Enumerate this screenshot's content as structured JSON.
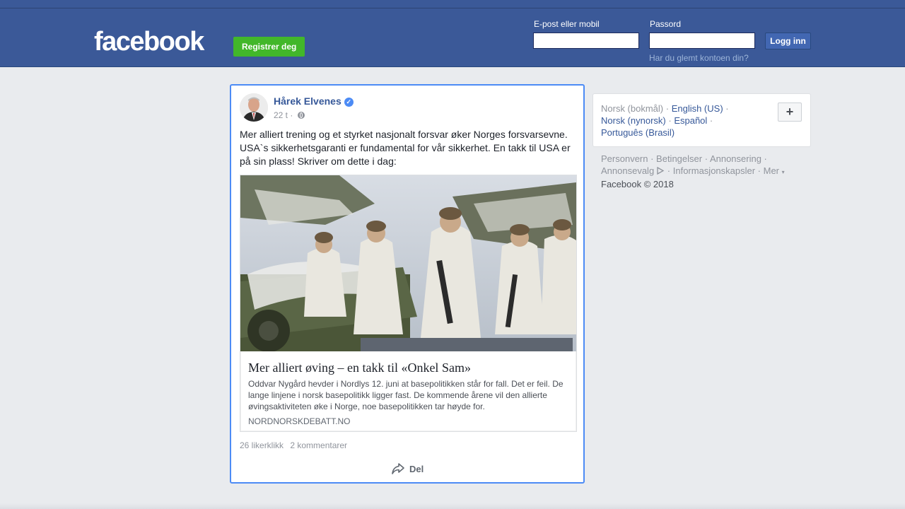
{
  "header": {
    "logo": "facebook",
    "register_label": "Registrer deg",
    "email_label": "E-post eller mobil",
    "password_label": "Passord",
    "login_label": "Logg inn",
    "forgot_label": "Har du glemt kontoen din?",
    "brand_color": "#3b5998"
  },
  "post": {
    "author": "Hårek Elvenes",
    "verified_icon": "verified-badge-icon",
    "time": "22 t",
    "separator": "·",
    "privacy_icon": "globe-icon",
    "text": "Mer alliert trening og et styrket nasjonalt forsvar øker Norges forsvarsevne. USA`s sikkerhetsgaranti er fundamental for vår sikkerhet. En takk til USA er på sin plass! Skriver om dette i dag:",
    "link": {
      "title": "Mer alliert øving – en takk til «Onkel Sam»",
      "description": "Oddvar Nygård hevder i Nordlys 12. juni at basepolitikken står for fall. Det er feil. De lange linjene i norsk basepolitikk ligger fast. De kommende årene vil den allierte øvingsaktiviteten øke i Norge, noe basepolitikken tar høyde for.",
      "domain": "NORDNORSKDEBATT.NO"
    },
    "likes": "26 likerklikk",
    "comments": "2 kommentarer",
    "share_label": "Del",
    "share_icon": "share-arrow-icon"
  },
  "sidebar": {
    "languages": [
      {
        "label": "Norsk (bokmål)",
        "current": true
      },
      {
        "label": "English (US)",
        "current": false
      },
      {
        "label": "Norsk (nynorsk)",
        "current": false
      },
      {
        "label": "Español",
        "current": false
      },
      {
        "label": "Português (Brasil)",
        "current": false
      }
    ],
    "add_language_label": "+",
    "footer": {
      "privacy": "Personvern",
      "terms": "Betingelser",
      "ads": "Annonsering",
      "ad_choices": "Annonsevalg",
      "cookies": "Informasjonskapsler",
      "more": "Mer",
      "copyright": "Facebook © 2018"
    }
  }
}
